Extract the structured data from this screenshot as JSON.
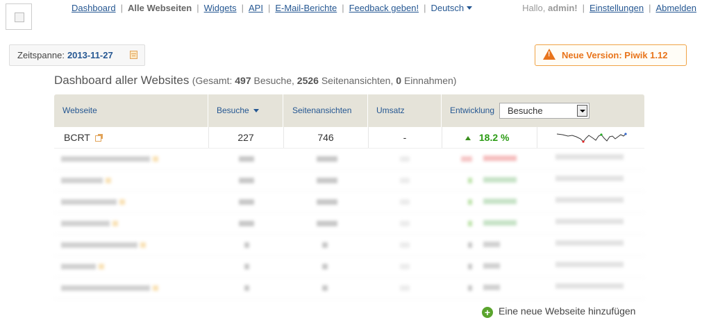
{
  "nav": {
    "items": [
      {
        "label": "Dashboard"
      },
      {
        "label": "Alle Webseiten",
        "active": true
      },
      {
        "label": "Widgets"
      },
      {
        "label": "API"
      },
      {
        "label": "E-Mail-Berichte"
      },
      {
        "label": "Feedback geben!"
      }
    ],
    "language": "Deutsch"
  },
  "user": {
    "hello_prefix": "Hallo,",
    "username": "admin!",
    "settings": "Einstellungen",
    "logout": "Abmelden"
  },
  "period": {
    "label": "Zeitspanne:",
    "date": "2013-11-27"
  },
  "update_notice": "Neue Version: Piwik 1.12",
  "summary": {
    "title": "Dashboard aller Websites",
    "gesamt": "(Gesamt:",
    "visits": "497",
    "visits_label": "Besuche,",
    "pageviews": "2526",
    "pageviews_label": "Seitenansichten,",
    "revenue": "0",
    "revenue_label": "Einnahmen)"
  },
  "table": {
    "columns": {
      "site": "Webseite",
      "visits": "Besuche",
      "pageviews": "Seitenansichten",
      "revenue": "Umsatz",
      "evolution": "Entwicklung"
    },
    "evolution_select": "Besuche",
    "rows": [
      {
        "site": "BCRT",
        "visits": "227",
        "pageviews": "746",
        "revenue": "-",
        "growth": "18.2 %"
      }
    ],
    "blurred_row_count": 7
  },
  "add_site": "Eine neue Webseite hinzufügen",
  "colors": {
    "link": "#255792",
    "header_bg": "#e5e3d9",
    "growth_green": "#2c9c15",
    "update_orange": "#e8741b"
  }
}
